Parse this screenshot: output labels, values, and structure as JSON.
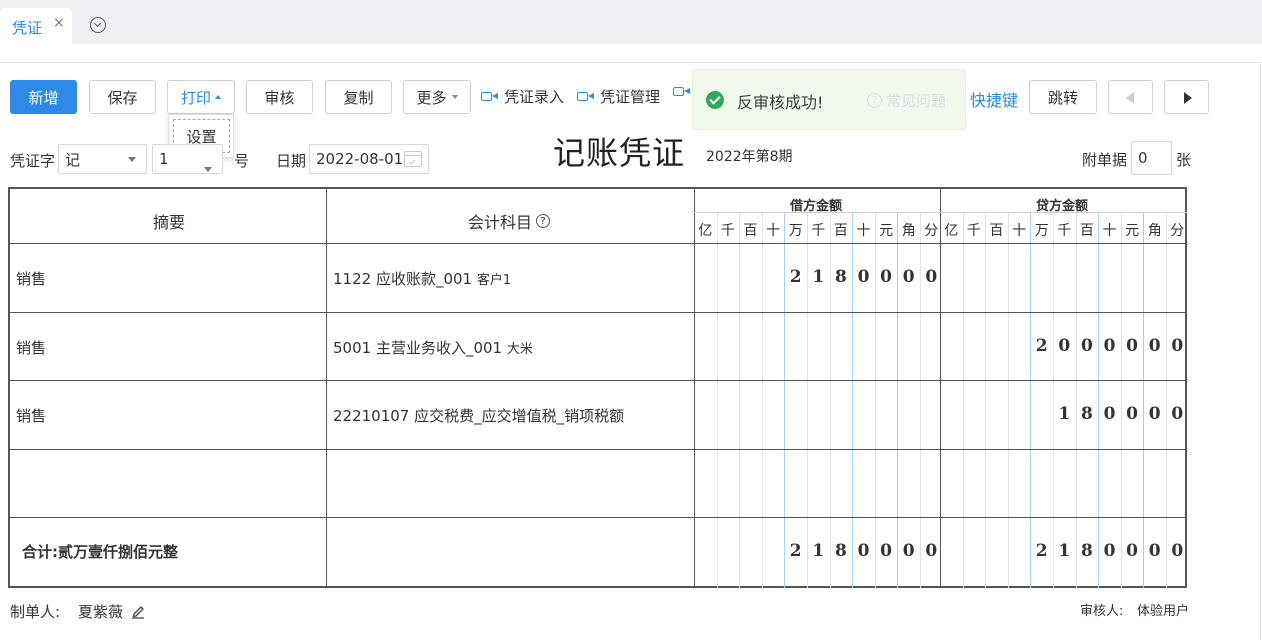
{
  "tabs": {
    "active_label": "凭证",
    "close_symbol": "×"
  },
  "toolbar": {
    "add": "新增",
    "save": "保存",
    "print": "打印",
    "print_menu": [
      "设置"
    ],
    "audit": "审核",
    "copy": "复制",
    "more": "更多",
    "voucher_entry": "凭证录入",
    "voucher_manage": "凭证管理",
    "shortcuts": "快捷键",
    "jump": "跳转"
  },
  "toast": {
    "message": "反审核成功!",
    "faq": "常见问题"
  },
  "header": {
    "word_label": "凭证字",
    "word_value": "记",
    "number_value": "1",
    "number_suffix": "号",
    "date_label": "日期",
    "date_value": "2022-08-01",
    "title": "记账凭证",
    "period": "2022年第8期",
    "attach_label": "附单据",
    "attach_value": "0",
    "attach_suffix": "张"
  },
  "table": {
    "col_summary": "摘要",
    "col_account": "会计科目",
    "col_debit": "借方金额",
    "col_credit": "贷方金额",
    "digit_units": [
      "亿",
      "千",
      "百",
      "十",
      "万",
      "千",
      "百",
      "十",
      "元",
      "角",
      "分"
    ],
    "rows": [
      {
        "summary": "销售",
        "account": "1122 应收账款_001",
        "account_sub": "客户1",
        "debit": "2180000",
        "credit": ""
      },
      {
        "summary": "销售",
        "account": "5001 主营业务收入_001",
        "account_sub": "大米",
        "debit": "",
        "credit": "2000000"
      },
      {
        "summary": "销售",
        "account": "22210107 应交税费_应交增值税_销项税额",
        "account_sub": "",
        "debit": "",
        "credit": "180000"
      },
      {
        "summary": "",
        "account": "",
        "account_sub": "",
        "debit": "",
        "credit": ""
      }
    ],
    "total_label": "合计:贰万壹仟捌佰元整",
    "total_debit": "2180000",
    "total_credit": "2180000"
  },
  "footer": {
    "maker_label": "制单人:",
    "maker_value": "夏紫薇",
    "auditor_label": "审核人:",
    "auditor_value": "体验用户"
  },
  "colors": {
    "accent": "#2e8ae6",
    "success": "#2aa450",
    "toast_bg": "#f0f9eb"
  }
}
